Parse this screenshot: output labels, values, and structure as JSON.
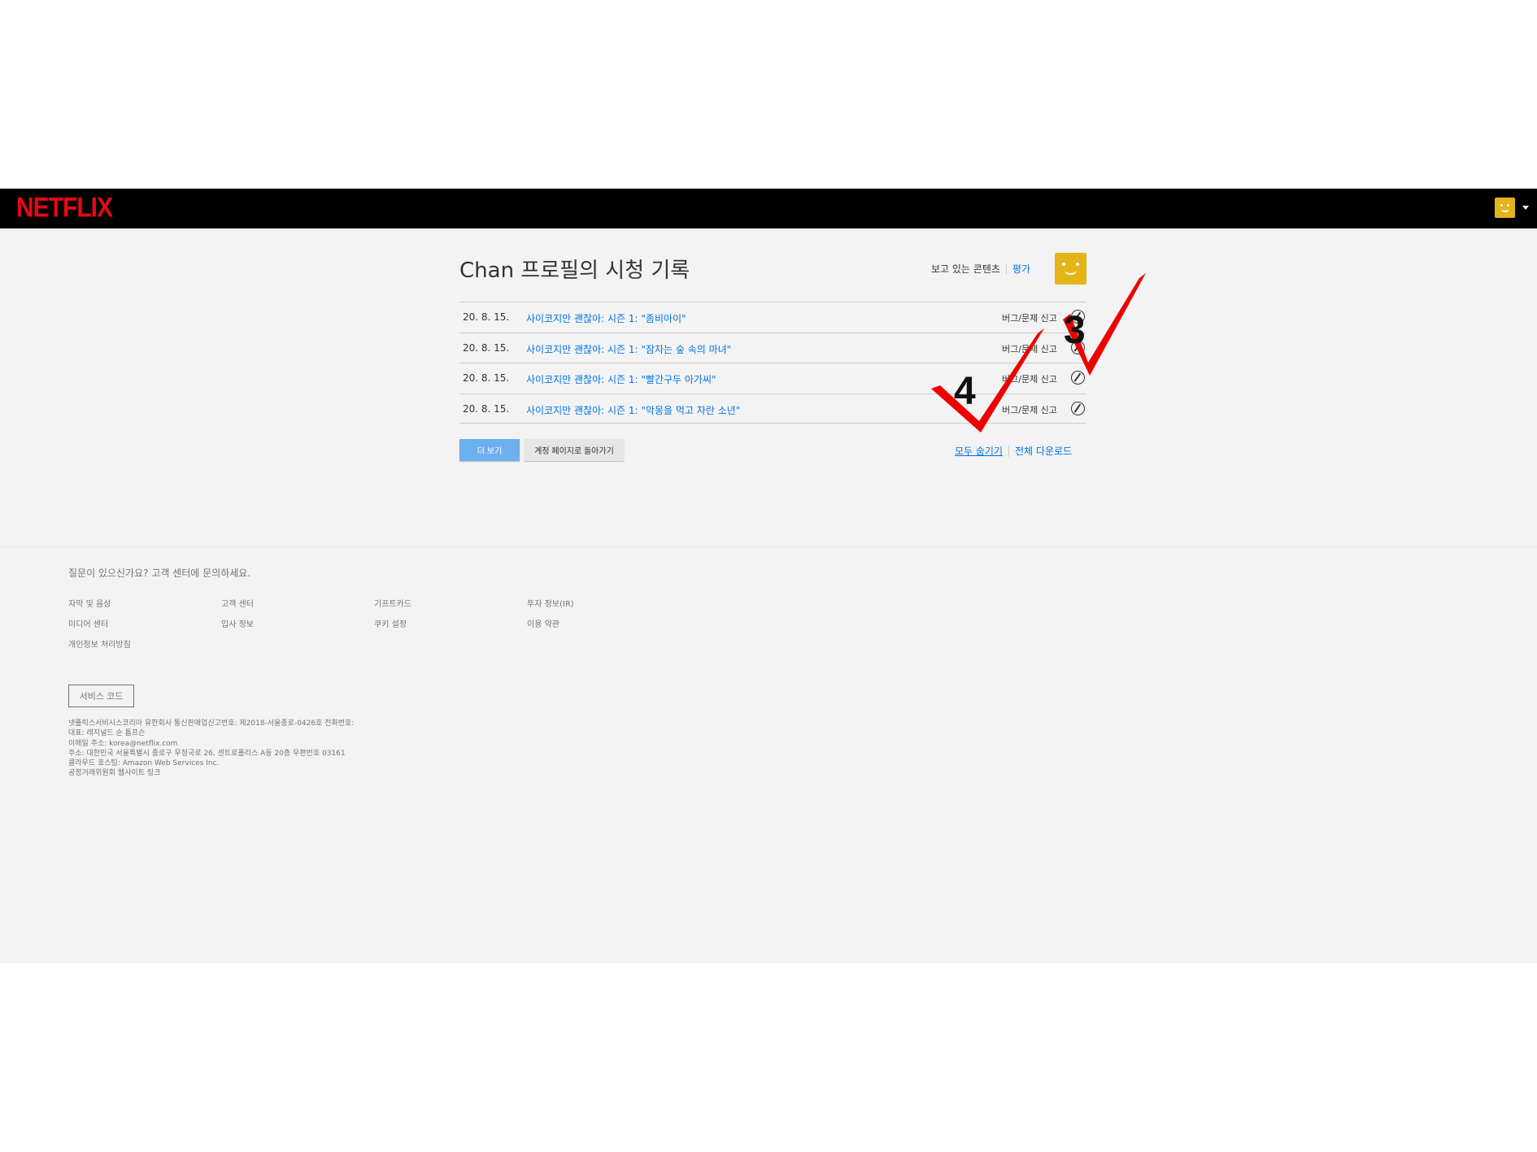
{
  "header": {
    "logo": "NETFLIX"
  },
  "main": {
    "title": "Chan 프로필의 시청 기록",
    "watching_label": "보고 있는 콘텐츠",
    "rating_label": "평가",
    "rows": [
      {
        "date": "20. 8. 15.",
        "title": "사이코지만 괜찮아: 시즌 1: \"좀비아이\"",
        "report": "버그/문제 신고"
      },
      {
        "date": "20. 8. 15.",
        "title": "사이코지만 괜찮아: 시즌 1: \"잠자는 숲 속의 마녀\"",
        "report": "버그/문제 신고"
      },
      {
        "date": "20. 8. 15.",
        "title": "사이코지만 괜찮아: 시즌 1: \"빨간구두 아가씨\"",
        "report": "버그/문제 신고"
      },
      {
        "date": "20. 8. 15.",
        "title": "사이코지만 괜찮아: 시즌 1: \"악몽을 먹고 자란 소년\"",
        "report": "버그/문제 신고"
      }
    ],
    "more_button": "더 보기",
    "back_button": "계정 페이지로 돌아가기",
    "hide_all": "모두 숨기기",
    "download_all": "전체 다운로드"
  },
  "annotations": {
    "step_a": "3",
    "step_b": "4",
    "color": "#ee0000"
  },
  "footer": {
    "question": "질문이 있으신가요? 고객 센터에 문의하세요.",
    "links": {
      "subtitles": "자막 및 음성",
      "help_center": "고객 센터",
      "gift_cards": "기프트카드",
      "investor": "투자 정보(IR)",
      "media": "미디어 센터",
      "jobs": "입사 정보",
      "cookies": "쿠키 설정",
      "terms": "이용 약관",
      "privacy": "개인정보 처리방침"
    },
    "service_code": "서비스 코드",
    "legal": [
      "넷플릭스서비시스코리아 유한회사 통신판매업신고번호: 제2018-서울종로-0426호 전화번호:",
      "대표: 레지널드 숀 톰프슨",
      "이메일 주소: korea@netflix.com",
      "주소: 대한민국 서울특별시 종로구 우정국로 26, 센트로폴리스 A동 20층 우편번호 03161",
      "클라우드 호스팅: Amazon Web Services Inc.",
      "공정거래위원회 웹사이트 링크"
    ]
  },
  "colors": {
    "brand": "#e50914",
    "link": "#0073e6",
    "avatar": "#e5b418",
    "background": "#f3f3f3"
  }
}
